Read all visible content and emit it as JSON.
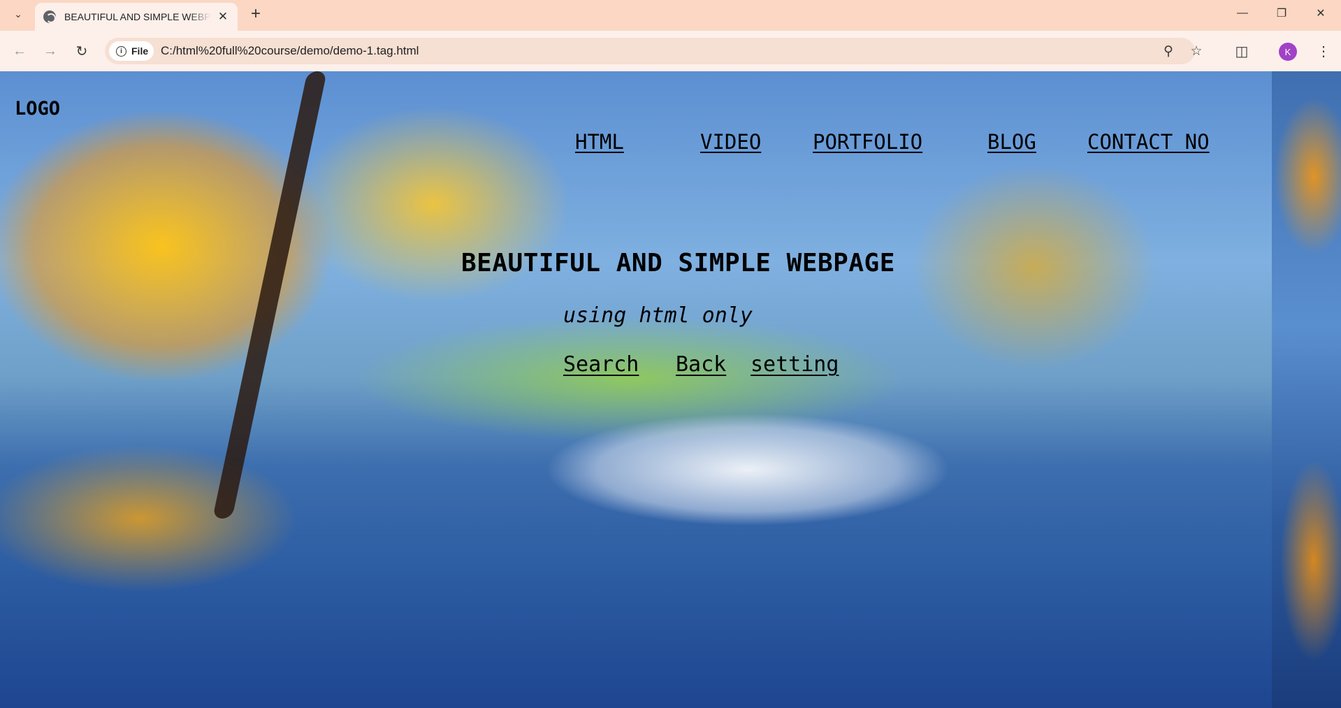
{
  "browser": {
    "tab_title": "BEAUTIFUL AND SIMPLE WEBPAGE",
    "new_tab_symbol": "+",
    "site_chip_label": "File",
    "url": "C:/html%20full%20course/demo/demo-1.tag.html",
    "profile_initial": "K",
    "accent_color": "#fbd7c4",
    "profile_color": "#a142c7"
  },
  "page": {
    "logo": "LOGO",
    "nav": [
      "HTML",
      "VIDEO",
      "PORTFOLIO",
      "BLOG",
      "CONTACT NO"
    ],
    "title": "BEAUTIFUL AND SIMPLE WEBPAGE",
    "subtitle": "using html only",
    "links": [
      "Search",
      "Back",
      "setting"
    ]
  },
  "icons": {
    "tab_menu": "chevron-down-icon",
    "favicon": "globe-icon",
    "close": "close-icon",
    "back": "arrow-left-icon",
    "forward": "arrow-right-icon",
    "reload": "reload-icon",
    "zoom": "zoom-icon",
    "bookmark": "star-icon",
    "extensions": "puzzle-icon",
    "menu": "kebab-menu-icon"
  }
}
